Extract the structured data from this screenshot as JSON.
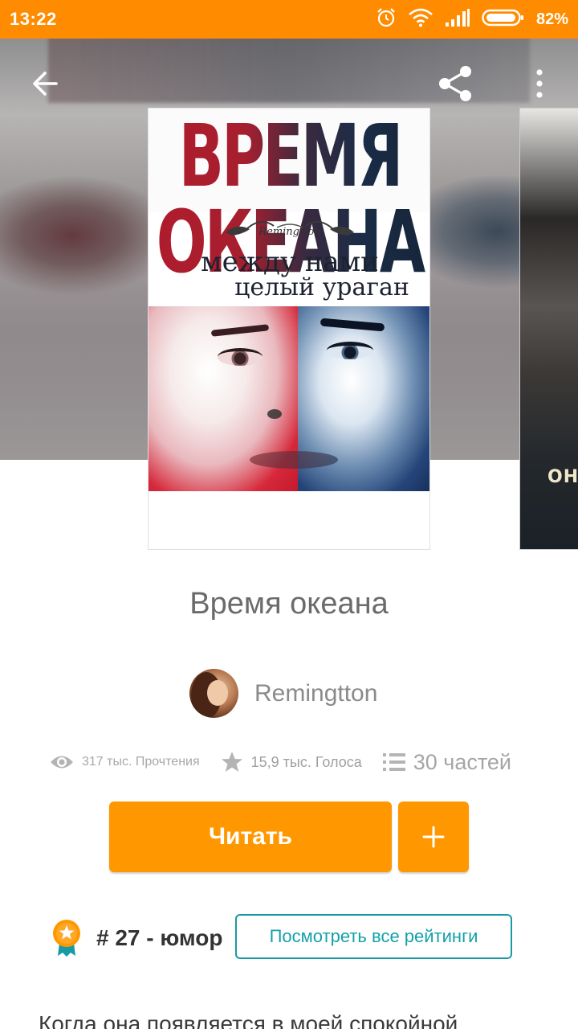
{
  "status_bar": {
    "time": "13:22",
    "battery": "82%",
    "icons": [
      "alarm-icon",
      "wifi-icon",
      "signal-icon",
      "battery-icon"
    ]
  },
  "toolbar": {
    "back_icon": "arrow-left-icon",
    "share_icon": "share-icon",
    "more_icon": "more-vertical-icon"
  },
  "cover": {
    "title": "ВРЕМЯ ОКЕАНА",
    "logo": "Remingtton",
    "subtitle_line1": "между нами",
    "subtitle_line2": "целый ураган",
    "next_cover_text": "ОНИ"
  },
  "book": {
    "title": "Время океана",
    "author": "Remingtton"
  },
  "stats": {
    "reads": "317 тыс. Прочтения",
    "votes": "15,9 тыс. Голоса",
    "parts": "30 частей"
  },
  "actions": {
    "read_label": "Читать",
    "add_label": "+"
  },
  "ranking": {
    "text": "# 27 - юмор",
    "button_label": "Посмотреть все рейтинги"
  },
  "description": "Когда она появляется в моей спокойной",
  "colors": {
    "status_bar": "#FF8C00",
    "accent": "#FF9800",
    "link": "#169BA6"
  }
}
